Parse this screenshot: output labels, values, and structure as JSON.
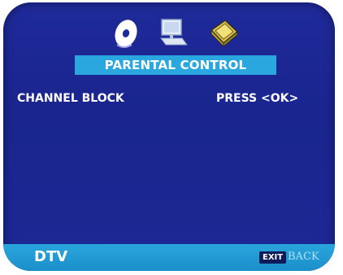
{
  "screen": {
    "title": "PARENTAL CONTROL",
    "menu": [
      {
        "label": "CHANNEL BLOCK",
        "value": "PRESS <OK>"
      }
    ],
    "footer": {
      "source": "DTV",
      "exit_key": "EXIT",
      "back_label": "BACK"
    },
    "top_icons": [
      "disc-icon",
      "computer-icon",
      "package-icon"
    ]
  },
  "colors": {
    "background": "#1f2a9a",
    "accent": "#2aa7de",
    "text": "#ffffff"
  }
}
